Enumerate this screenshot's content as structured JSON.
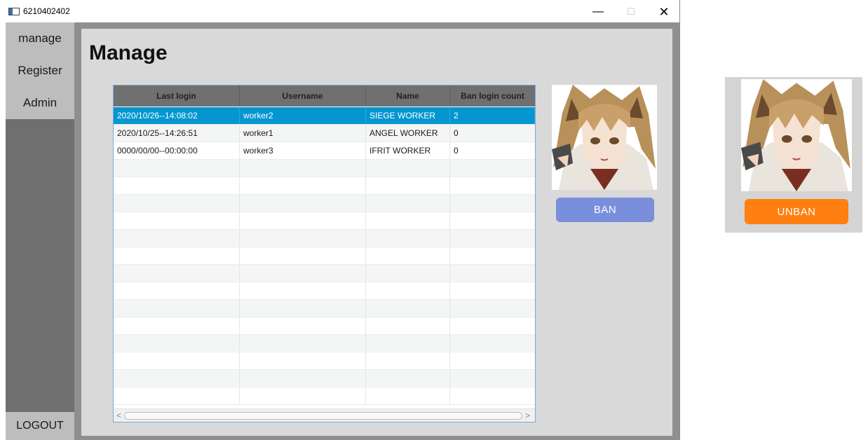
{
  "window": {
    "title": "6210402402",
    "minimize_glyph": "—",
    "maximize_glyph": "☐",
    "close_glyph": "✕"
  },
  "sidebar": {
    "items": [
      {
        "label": "manage"
      },
      {
        "label": "Register"
      },
      {
        "label": "Admin"
      }
    ],
    "logout_label": "LOGOUT"
  },
  "main": {
    "page_title": "Manage",
    "table": {
      "columns": [
        "Last login",
        "Username",
        "Name",
        "Ban login count"
      ],
      "rows": [
        [
          "2020/10/26--14:08:02",
          "worker2",
          "SIEGE WORKER",
          "2"
        ],
        [
          "2020/10/25--14:26:51",
          "worker1",
          "ANGEL WORKER",
          "0"
        ],
        [
          "0000/00/00--00:00:00",
          "worker3",
          "IFRIT WORKER",
          "0"
        ]
      ],
      "selected_row": 0,
      "empty_rows": 14,
      "scroll_left_glyph": "<",
      "scroll_right_glyph": ">"
    },
    "ban_label": "BAN"
  },
  "side_panel": {
    "unban_label": "UNBAN"
  },
  "colors": {
    "selected_row": "#0596d0",
    "ban_button": "#7a8fdb",
    "unban_button": "#ff7f10",
    "table_header": "#707070",
    "sidebar": "#6f6f6f"
  }
}
